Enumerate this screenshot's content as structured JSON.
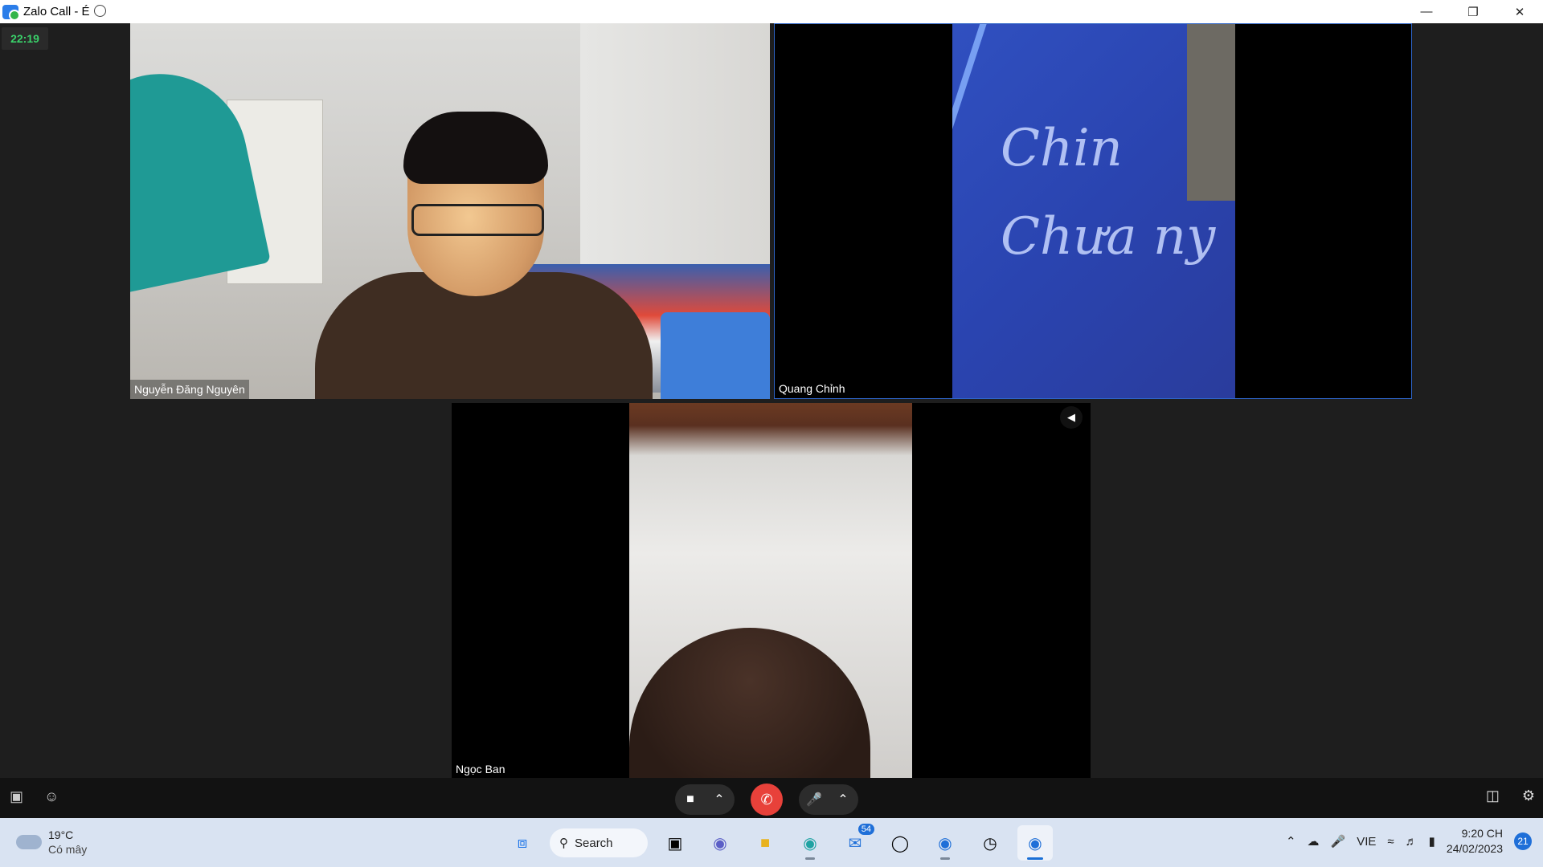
{
  "window": {
    "title": "Zalo Call - É",
    "controls": {
      "minimize": "—",
      "restore": "❐",
      "close": "✕"
    }
  },
  "call": {
    "timer": "22:19",
    "participants": [
      {
        "name": "Nguyễn Đăng Nguyên"
      },
      {
        "name": "Quang Chỉnh",
        "overlay_text": "Chin Chưa ny"
      },
      {
        "name": "Ngọc Ban"
      }
    ]
  },
  "taskbar": {
    "weather": {
      "temp": "19°C",
      "condition": "Có mây"
    },
    "search_label": "Search",
    "mail_badge": "54",
    "apps": [
      "start-icon",
      "search",
      "task-view-icon",
      "teams-icon",
      "file-explorer-icon",
      "edge-icon",
      "mail-icon",
      "dell-icon",
      "zalo-icon",
      "clock-app-icon",
      "zalo-call-icon"
    ],
    "tray": {
      "language": "VIE",
      "time": "9:20 CH",
      "date": "24/02/2023",
      "notifications": "21"
    }
  }
}
